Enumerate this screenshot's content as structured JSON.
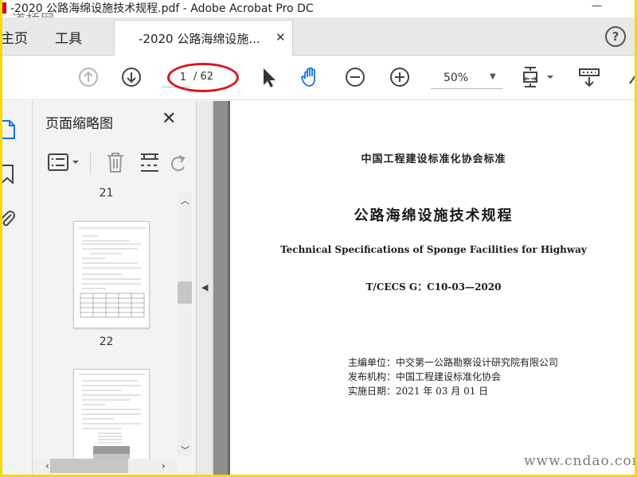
{
  "window": {
    "title": "-2020 公路海绵设施技术规程.pdf - Adobe Acrobat Pro DC"
  },
  "watermarks": {
    "top": "道桥网",
    "bottom": "www.cndao.com"
  },
  "tabs": {
    "home": "主页",
    "tools": "工具",
    "document": "-2020 公路海绵设施..."
  },
  "toolbar": {
    "page_current": "1",
    "page_total": "/ 62",
    "zoom": "50%",
    "icons": [
      "prev-page-icon",
      "next-page-icon",
      "select-arrow-icon",
      "hand-tool-icon",
      "zoom-out-icon",
      "zoom-in-icon",
      "fit-page-icon",
      "scroll-mode-icon"
    ]
  },
  "sidebar": {
    "title": "页面缩略图",
    "thumbnails": [
      {
        "label": "21"
      },
      {
        "label": "22"
      }
    ]
  },
  "document": {
    "org": "中国工程建设标准化协会标准",
    "title_cn": "公路海绵设施技术规程",
    "title_en": "Technical Specifications of Sponge Facilities for Highway",
    "code": "T/CECS G：C10-03—2020",
    "editor": "主编单位：中交第一公路勘察设计研究院有限公司",
    "publisher": "发布机构：中国工程建设标准化协会",
    "effective": "实施日期：2021 年 03 月 01 日"
  },
  "colors": {
    "highlight_ellipse": "#d9141f",
    "hand_tool": "#1473e6",
    "frame": "#f5d90a"
  }
}
